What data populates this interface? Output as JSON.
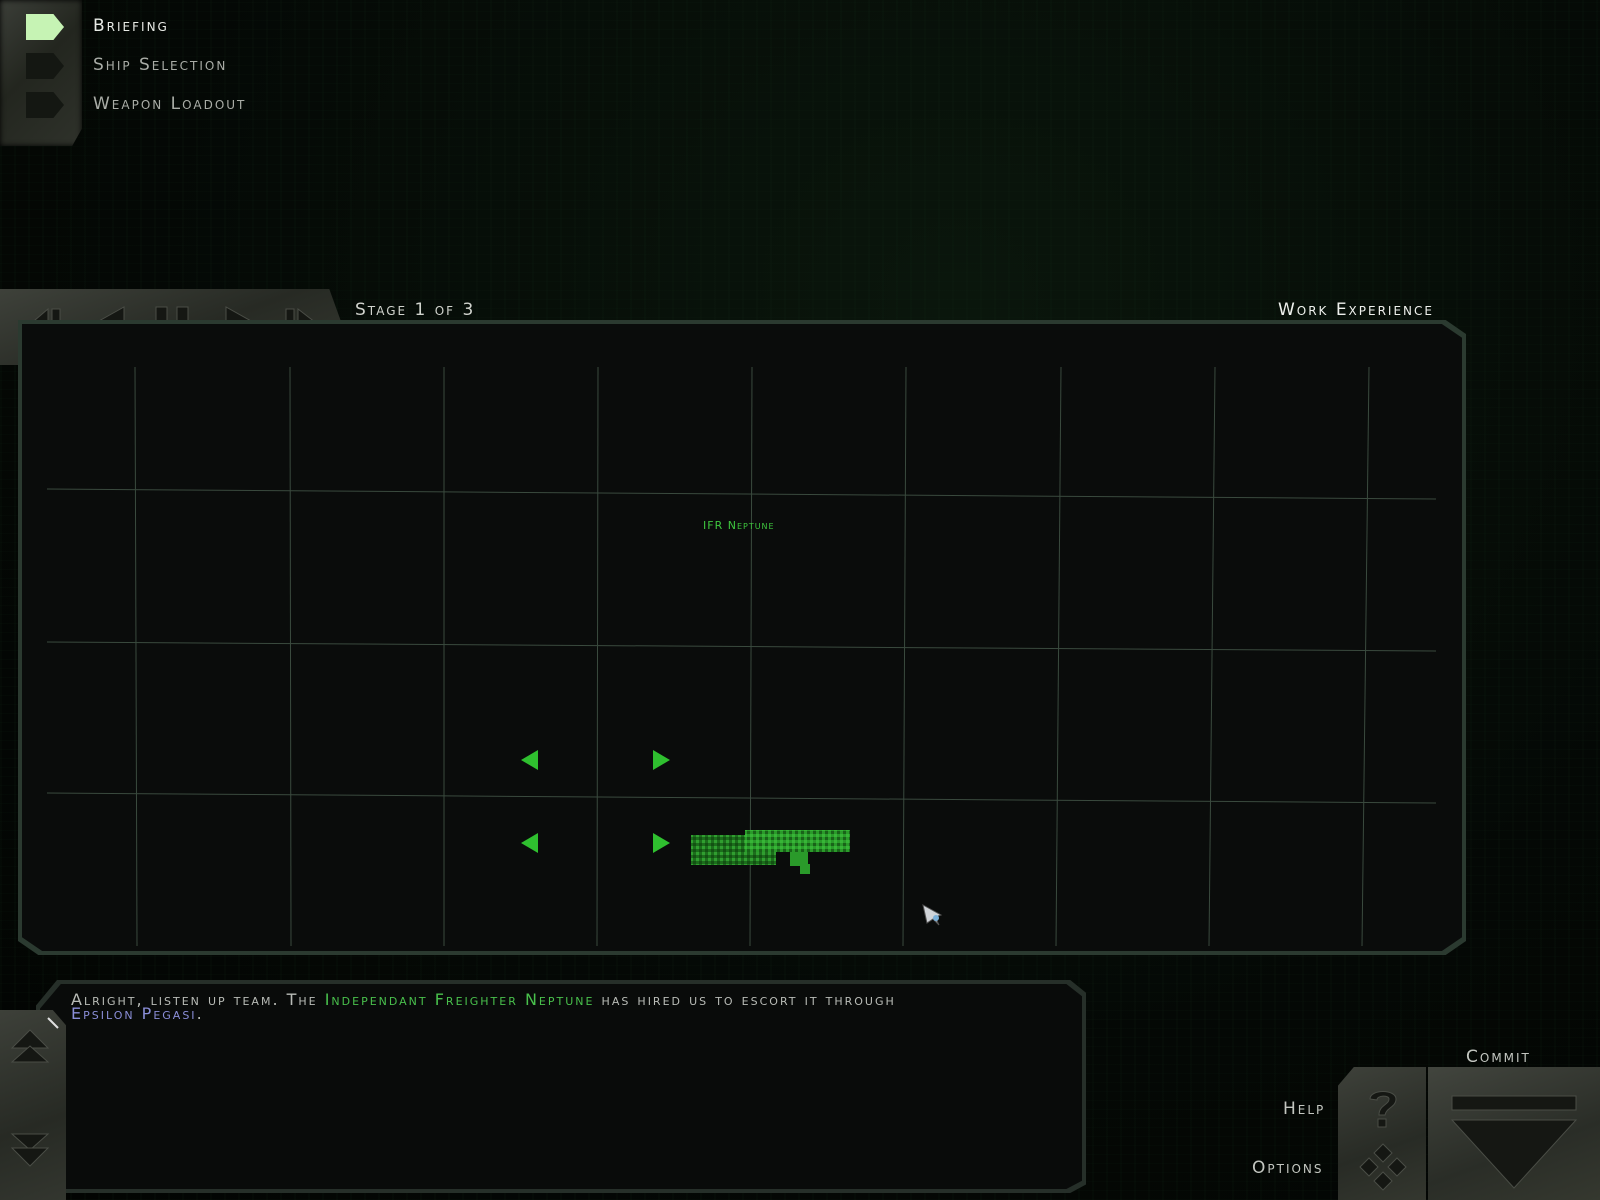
{
  "nav": {
    "items": [
      {
        "label": "Briefing",
        "active": true
      },
      {
        "label": "Ship Selection",
        "active": false
      },
      {
        "label": "Weapon Loadout",
        "active": false
      }
    ]
  },
  "playback": {
    "icons": [
      "skip-to-start-icon",
      "previous-icon",
      "pause-icon",
      "next-icon",
      "skip-to-end-icon"
    ]
  },
  "briefing": {
    "stage": "Stage 1 of 3",
    "mission_title": "Work Experience",
    "map": {
      "ship_label": "IFR Neptune",
      "grid_color": "#3a4a3e",
      "marker_color": "#2fc02f",
      "ship_icon": "freighter-ship-icon",
      "waypoint_icon": "triangle-marker-icon"
    },
    "dialogue": {
      "part1": "Alright, listen up team. The ",
      "highlight1": "Independant Freighter Neptune",
      "part2": " has hired us to escort it through ",
      "highlight2": "Epsilon Pegasi",
      "part3": "."
    }
  },
  "controls": {
    "help_label": "Help",
    "options_label": "Options",
    "commit_label": "Commit"
  },
  "colors": {
    "accent_green": "#49c04c",
    "highlight_blue": "#8a8ed8",
    "active_nav": "#c6f3b4"
  }
}
